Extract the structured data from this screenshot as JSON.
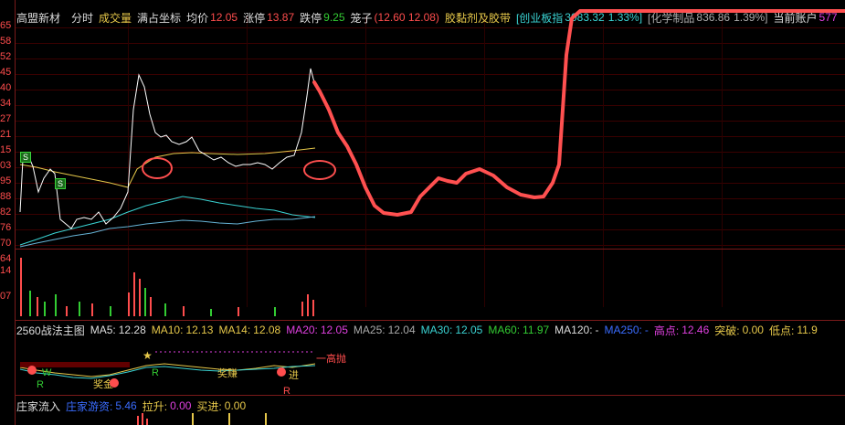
{
  "header": {
    "stock_name": "高盟新材",
    "tab_timeshare": "分时",
    "volume_label": "成交量",
    "full_coord": "满占坐标",
    "avg_label": "均价",
    "avg_value": "12.05",
    "limit_up_label": "涨停",
    "limit_up_value": "13.87",
    "limit_down_label": "跌停",
    "limit_down_value": "9.25",
    "cage_label": "笼子",
    "cage_value": "(12.60 12.08)",
    "sector_name": "胶黏剂及胶带",
    "index_name": "[创业板指",
    "index_value": "3083.32",
    "index_change": "1.33%]",
    "index2_name": "[化学制品",
    "index2_value": "836.86",
    "index2_change": "1.39%]",
    "account_label": "当前账户",
    "account_value": "577"
  },
  "y_axis": {
    "labels": [
      "65",
      "58",
      "52",
      "45",
      "40",
      "34",
      "27",
      "21",
      "15",
      "03",
      "95",
      "88",
      "82",
      "76",
      "70",
      "64",
      "21"
    ]
  },
  "vol_axis": {
    "labels": [
      "14",
      "07"
    ]
  },
  "ma_bar": {
    "title": "2560战法主图",
    "ma5_label": "MA5:",
    "ma5_value": "12.28",
    "ma10_label": "MA10:",
    "ma10_value": "12.13",
    "ma14_label": "MA14:",
    "ma14_value": "12.08",
    "ma20_label": "MA20:",
    "ma20_value": "12.05",
    "ma25_label": "MA25:",
    "ma25_value": "12.04",
    "ma30_label": "MA30:",
    "ma30_value": "12.05",
    "ma60_label": "MA60:",
    "ma60_value": "11.97",
    "ma120_label": "MA120:",
    "ma120_value": "-",
    "ma250_label": "MA250:",
    "ma250_value": "-",
    "high_label": "高点:",
    "high_value": "12.46",
    "break_label": "突破:",
    "break_value": "0.00",
    "low_label": "低点:",
    "low_value": "11.9"
  },
  "signals": {
    "s1": "S",
    "s2": "S",
    "w": "W",
    "r1": "R",
    "r2": "R",
    "r3": "R",
    "jiangjin1": "奖金",
    "jiangjin2": "奖赚",
    "jin": "进",
    "yi_gao_bi": "一高抛"
  },
  "bottom_bar": {
    "title": "庄家流入",
    "flow_label": "庄家游资:",
    "flow_value": "5.46",
    "up_label": "拉升:",
    "up_value": "0.00",
    "buy_label": "买进:",
    "buy_value": "0.00"
  },
  "colors": {
    "price_line": "#ffffff",
    "avg_line": "#e6c84a",
    "ma_cyan": "#3ad3d3",
    "annotation": "#ff4f4f"
  }
}
